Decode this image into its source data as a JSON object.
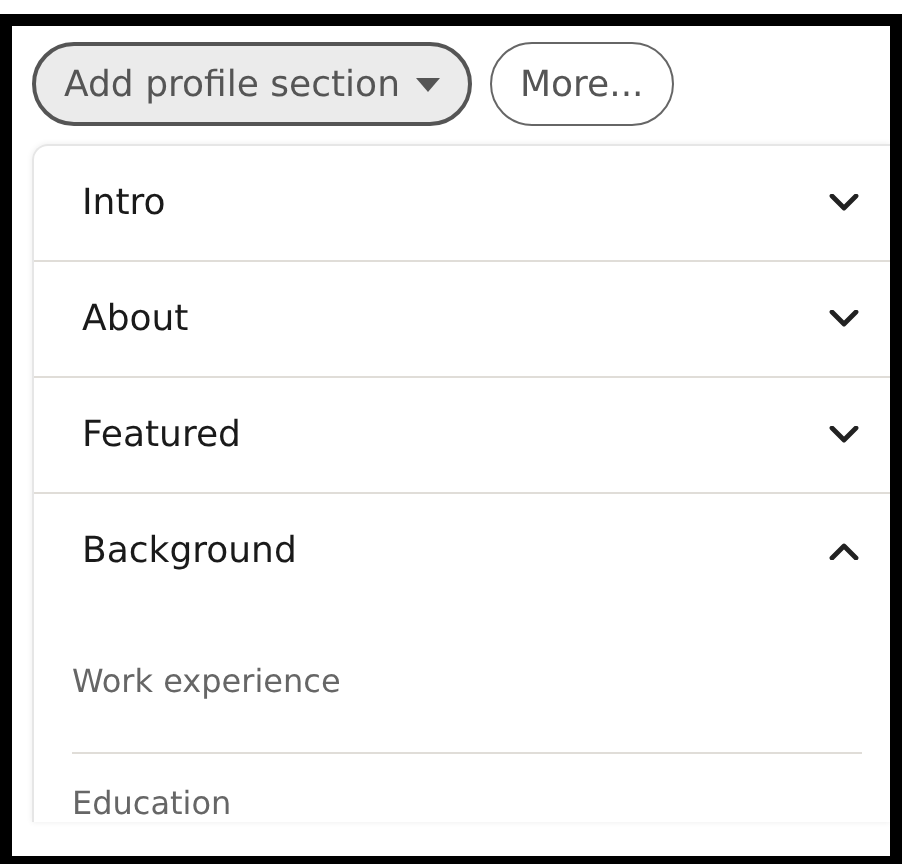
{
  "buttons": [
    {
      "label": "Add profile section",
      "kind": "dropdown",
      "pressed": true
    },
    {
      "label": "More...",
      "kind": "plain",
      "pressed": false
    }
  ],
  "sections": [
    {
      "title": "Intro",
      "expanded": false
    },
    {
      "title": "About",
      "expanded": false
    },
    {
      "title": "Featured",
      "expanded": false
    },
    {
      "title": "Background",
      "expanded": true,
      "items": [
        "Work experience",
        "Education"
      ]
    }
  ]
}
